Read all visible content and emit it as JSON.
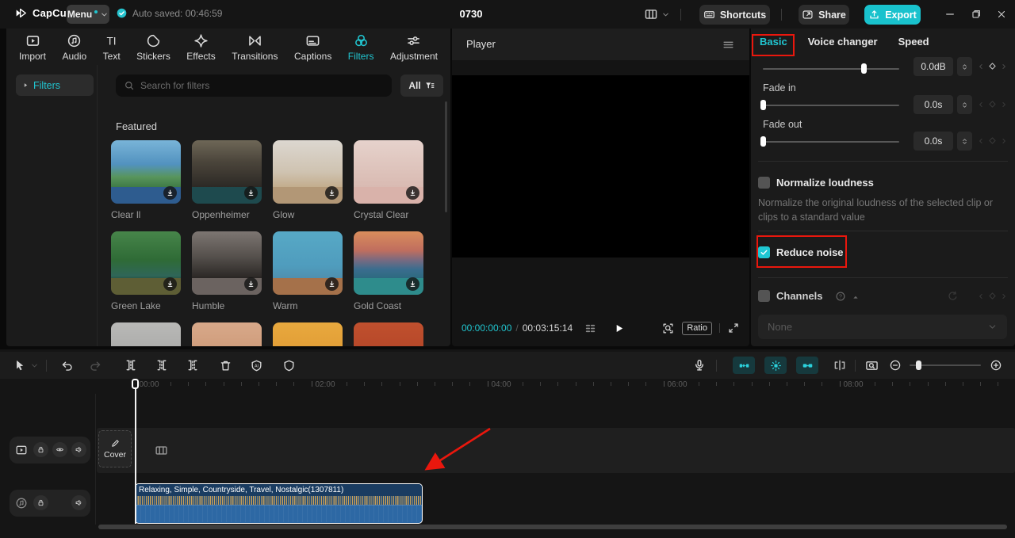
{
  "app": {
    "name": "CapCut",
    "window_title": "0730"
  },
  "colors": {
    "accent": "#21c6d1",
    "export_button": "#19c2cd",
    "annotation_red": "#ea170d",
    "clip_body_blue": "#2d68a4",
    "clip_header_blue": "#1a3c61",
    "waveform_orange": "#c79e58"
  },
  "topbar": {
    "logo_text": "CapCut",
    "menu_label": "Menu",
    "autosave_text": "Auto saved: 00:46:59",
    "project_title": "0730",
    "shortcuts_label": "Shortcuts",
    "share_label": "Share",
    "export_label": "Export"
  },
  "media_tabs": {
    "items": [
      {
        "label": "Import",
        "icon": "import"
      },
      {
        "label": "Audio",
        "icon": "audio"
      },
      {
        "label": "Text",
        "icon": "text"
      },
      {
        "label": "Stickers",
        "icon": "stickers"
      },
      {
        "label": "Effects",
        "icon": "effects"
      },
      {
        "label": "Transitions",
        "icon": "transitions"
      },
      {
        "label": "Captions",
        "icon": "captions"
      },
      {
        "label": "Filters",
        "icon": "filters",
        "active": true
      },
      {
        "label": "Adjustment",
        "icon": "adjustment"
      }
    ]
  },
  "filters_panel": {
    "sidebar_item_label": "Filters",
    "search_placeholder": "Search for filters",
    "filter_all_label": "All",
    "section_title": "Featured",
    "featured_filters": [
      {
        "name": "Clear ll",
        "thumb": "linear-gradient(180deg,#79b4d8 0%,#5292bf 38%,#58955c 58%,#3f7a46 74%,#2e5c8f 74%,#2e5c8f 100%)"
      },
      {
        "name": "Oppenheimer",
        "thumb": "linear-gradient(180deg,#6e6757 0%,#4a443a 35%,#2c2925 74%,#1e4a4e 74%,#1e4a4e 100%)"
      },
      {
        "name": "Glow",
        "thumb": "linear-gradient(180deg,#dcd7d0 0%,#cfc3b1 50%,#c3ad8d 74%,#b29776 74%,#b29776 100%)"
      },
      {
        "name": "Crystal Clear",
        "thumb": "linear-gradient(180deg,#e6d2cc 0%,#ddc2ba 50%,#d9bab2 74%,#d9b2aa 74%,#d9b2aa 100%)"
      },
      {
        "name": "Green Lake",
        "thumb": "linear-gradient(180deg,#47854a 0%,#2f6b36 45%,#2f6658 70%,#27584a 74%,#5e5e35 74%,#5e5e35 100%)"
      },
      {
        "name": "Humble",
        "thumb": "linear-gradient(180deg,#7d7672 0%,#55504c 40%,#2a2624 74%,#6b6360 74%,#6b6360 100%)"
      },
      {
        "name": "Warm",
        "thumb": "linear-gradient(180deg,#57a9c6 0%,#4f9cbd 55%,#4f8fae 74%,#a5714a 74%,#a5714a 100%)"
      },
      {
        "name": "Gold Coast",
        "thumb": "linear-gradient(180deg,#d98d5c 0%,#c06e5e 30%,#7a6a80 45%,#3a6d8e 60%,#2d6a80 74%,#2e8c8c 74%,#2e8c8c 100%)"
      }
    ],
    "partial_row_thumbs": [
      "linear-gradient(180deg,#b9b9b7 0%,#9c9c9a 100%)",
      "linear-gradient(180deg,#d8a98a 0%,#c28a66 100%)",
      "linear-gradient(180deg,#e8a93e 0%,#d98e2c 100%)",
      "linear-gradient(180deg,#c0502e 0%,#a83c22 100%)"
    ]
  },
  "player": {
    "panel_title": "Player",
    "current_time": "00:00:00:00",
    "time_separator": "/",
    "duration": "00:03:15:14",
    "ratio_button_label": "Ratio"
  },
  "inspector": {
    "tabs": [
      {
        "label": "Basic",
        "active": true
      },
      {
        "label": "Voice changer",
        "active": false
      },
      {
        "label": "Speed",
        "active": false
      }
    ],
    "volume": {
      "value": "0.0dB",
      "slider_percent": 74
    },
    "fade_in": {
      "label": "Fade in",
      "value": "0.0s",
      "slider_percent": 0
    },
    "fade_out": {
      "label": "Fade out",
      "value": "0.0s",
      "slider_percent": 0
    },
    "normalize_loudness": {
      "label": "Normalize loudness",
      "checked": false,
      "description": "Normalize the original loudness of the selected clip or clips to a standard value"
    },
    "reduce_noise": {
      "label": "Reduce noise",
      "checked": true
    },
    "channels": {
      "label": "Channels",
      "checked": false,
      "dropdown_value": "None"
    }
  },
  "timeline": {
    "ruler_labels": [
      "00:00",
      "02:00",
      "04:00",
      "06:00",
      "08:00"
    ],
    "cover_button_label": "Cover",
    "audio_clip_title": "Relaxing, Simple, Countryside, Travel, Nostalgic(1307811)"
  }
}
